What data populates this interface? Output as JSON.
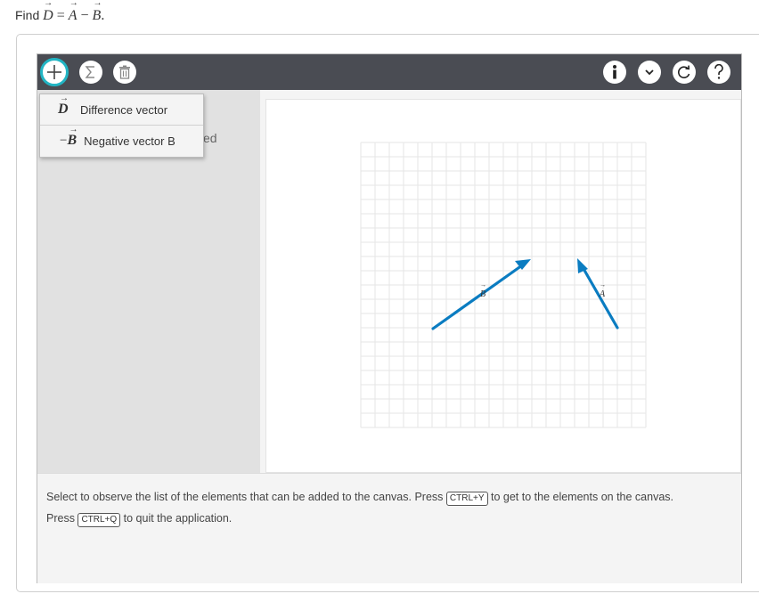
{
  "question": {
    "prefix": "Find",
    "D": "D",
    "equals": "=",
    "A": "A",
    "minus": "−",
    "B": "B",
    "period": "."
  },
  "toolbar": {
    "left_icons": [
      "plus-icon",
      "sigma-icon",
      "trash-icon"
    ],
    "right_icons": [
      "info-icon",
      "chevron-down-icon",
      "reset-icon",
      "help-icon"
    ],
    "accent_color": "#22b5c4",
    "bar_color": "#4a4c53"
  },
  "dropdown": {
    "items": [
      {
        "symbol": "D",
        "prefix": "",
        "label": "Difference vector"
      },
      {
        "symbol": "B",
        "prefix": "−",
        "label": "Negative vector B"
      }
    ]
  },
  "sidebar": {
    "partial_text": "ed"
  },
  "canvas": {
    "vector_color": "#0a7cc1",
    "vectors": [
      {
        "name": "B"
      },
      {
        "name": "A"
      }
    ]
  },
  "status": {
    "part1": "Select to observe the list of the elements that can be added to the canvas. Press",
    "key1": "CTRL+Y",
    "part2": "to get to the elements on the canvas.",
    "part3": "Press",
    "key2": "CTRL+Q",
    "part4": "to quit the application."
  }
}
